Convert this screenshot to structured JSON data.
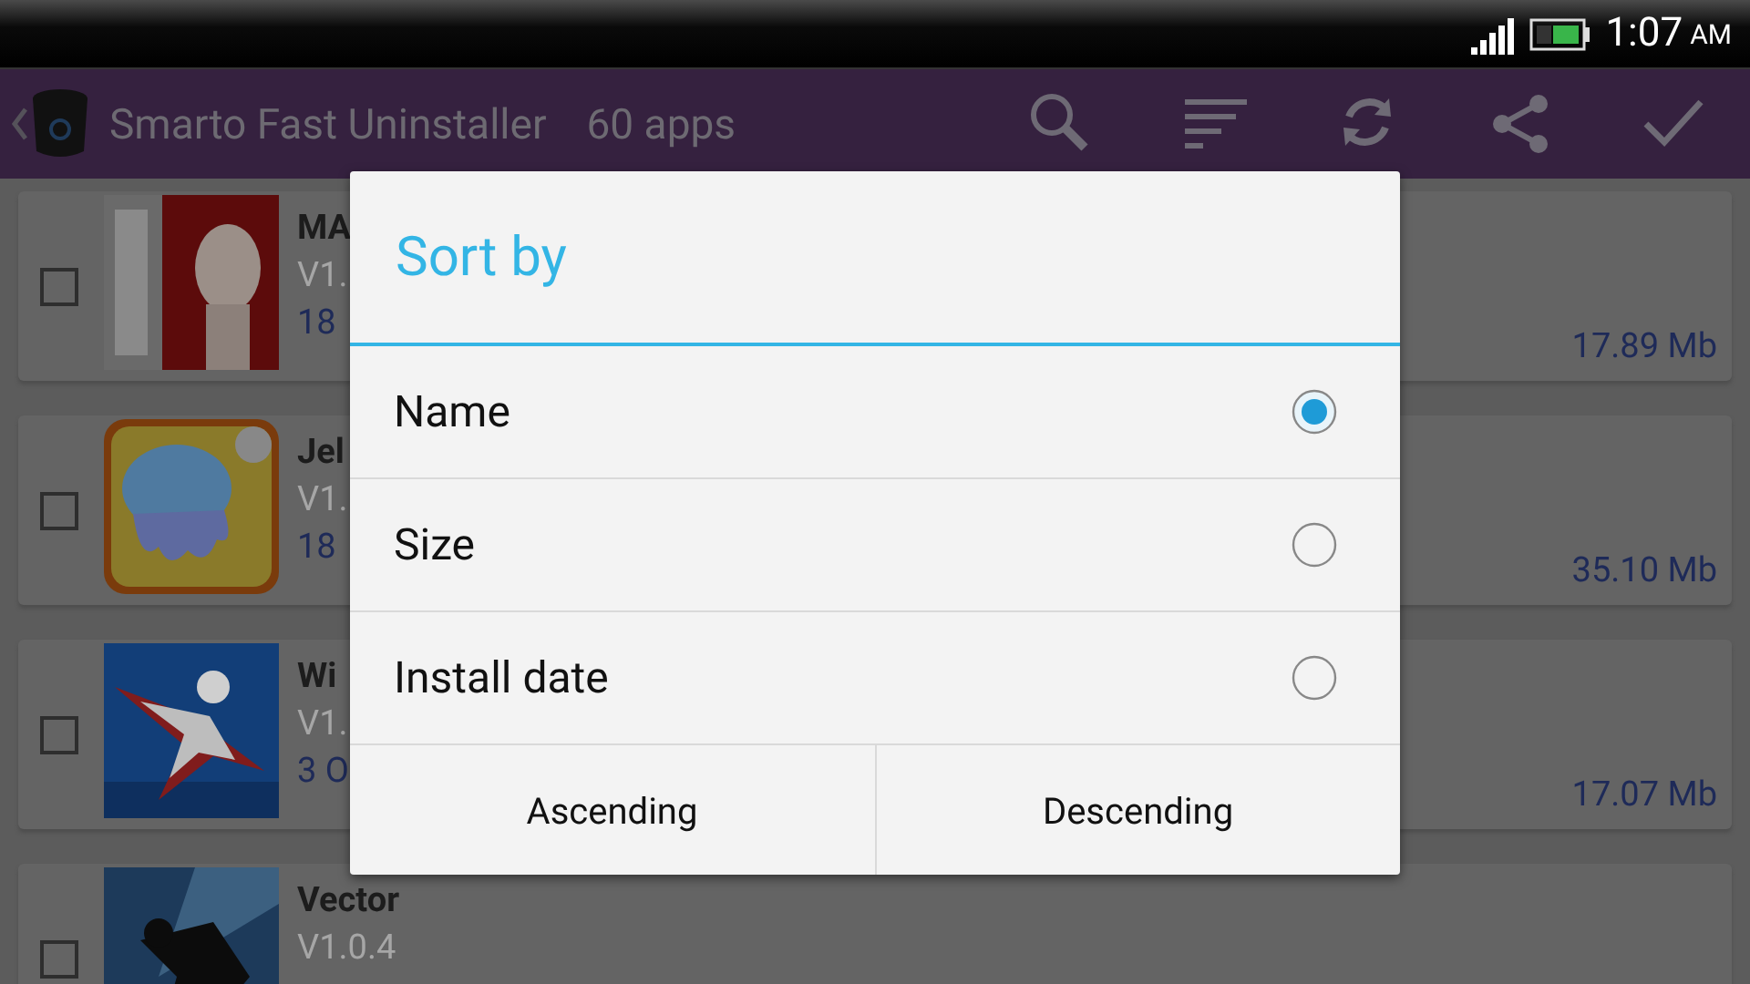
{
  "status_bar": {
    "time": "1:07",
    "meridiem": "AM"
  },
  "toolbar": {
    "title": "Smarto Fast Uninstaller",
    "count": "60 apps"
  },
  "apps": [
    {
      "name": "MA",
      "version": "V1.",
      "detail": "18",
      "size": "17.89 Mb",
      "checked": false
    },
    {
      "name": "Jel",
      "version": "V1.",
      "detail": "18",
      "size": "35.10 Mb",
      "checked": false
    },
    {
      "name": "Wi",
      "version": "V1.",
      "detail": "3 O",
      "size": "17.07 Mb",
      "checked": false
    },
    {
      "name": "Vector",
      "version": "V1.0.4",
      "checked": false
    }
  ],
  "dialog": {
    "title": "Sort by",
    "options": [
      {
        "label": "Name",
        "selected": true
      },
      {
        "label": "Size",
        "selected": false
      },
      {
        "label": "Install date",
        "selected": false
      }
    ],
    "buttons": [
      "Ascending",
      "Descending"
    ]
  }
}
